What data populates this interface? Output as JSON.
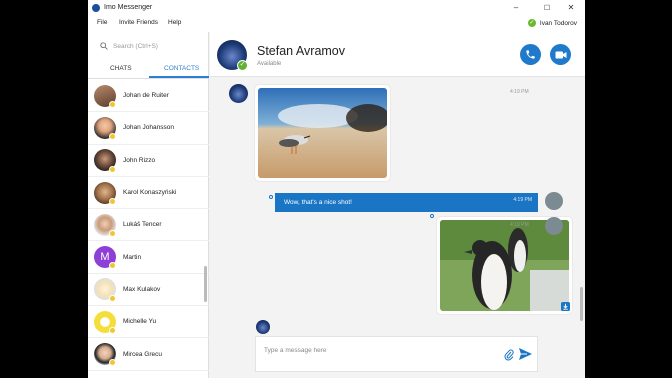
{
  "window": {
    "title": "Imo Messenger",
    "controls": {
      "minimize": "–",
      "maximize": "☐",
      "close": "✕"
    }
  },
  "menu": {
    "file": "File",
    "invite": "Invite Friends",
    "help": "Help"
  },
  "current_user": {
    "name": "Ivan Todorov",
    "status_icon": "check-icon",
    "status_color": "#6bb82c"
  },
  "sidebar": {
    "search_placeholder": "Search (Ctrl+S)",
    "tabs": [
      {
        "label": "CHATS",
        "active": false
      },
      {
        "label": "CONTACTS",
        "active": true
      }
    ],
    "contacts": [
      {
        "name": "Johan de Ruiter"
      },
      {
        "name": "Johan Johansson"
      },
      {
        "name": "John Rizzo"
      },
      {
        "name": "Karol Konaszyński"
      },
      {
        "name": "Lukáš Tencer"
      },
      {
        "name": "Martin",
        "initial": "M"
      },
      {
        "name": "Max Kulakov"
      },
      {
        "name": "Michelle  Yu"
      },
      {
        "name": "Mircea Grecu"
      }
    ]
  },
  "chat": {
    "contact_name": "Stefan Avramov",
    "contact_status": "Available",
    "messages": [
      {
        "type": "photo",
        "direction": "in",
        "subject": "bird on sand",
        "time": "4:19 PM"
      },
      {
        "type": "text",
        "direction": "out",
        "text": "Wow, that's a nice shot!",
        "time": "4:19 PM"
      },
      {
        "type": "photo",
        "direction": "out",
        "subject": "penguins",
        "time": "4:19 PM"
      }
    ],
    "composer_placeholder": "Type a message here"
  },
  "colors": {
    "accent": "#1a75c4",
    "badge": "#f2c62d",
    "online": "#5fb331"
  }
}
